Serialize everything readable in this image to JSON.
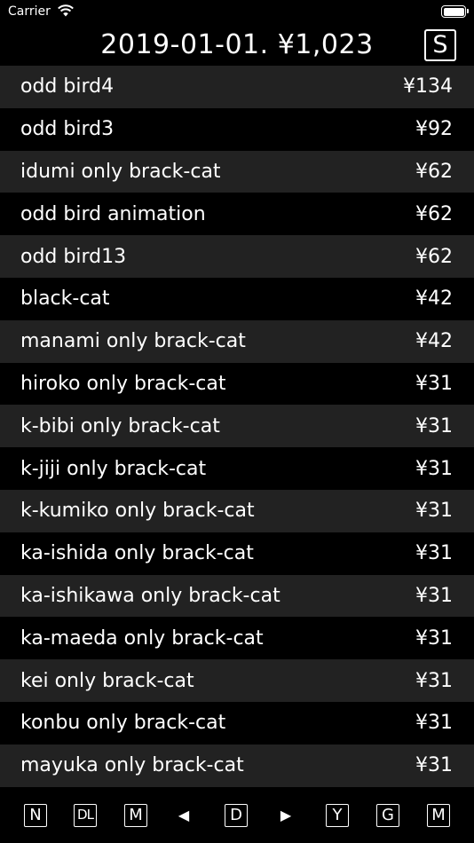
{
  "status": {
    "carrier": "Carrier"
  },
  "header": {
    "title": "2019-01-01.  ¥1,023",
    "s_label": "S"
  },
  "rows": [
    {
      "name": "odd bird4",
      "price": "¥134"
    },
    {
      "name": "odd bird3",
      "price": "¥92"
    },
    {
      "name": "idumi only brack-cat",
      "price": "¥62"
    },
    {
      "name": "odd bird animation",
      "price": "¥62"
    },
    {
      "name": "odd bird13",
      "price": "¥62"
    },
    {
      "name": "black-cat",
      "price": "¥42"
    },
    {
      "name": "manami only brack-cat",
      "price": "¥42"
    },
    {
      "name": "hiroko only brack-cat",
      "price": "¥31"
    },
    {
      "name": "k-bibi only brack-cat",
      "price": "¥31"
    },
    {
      "name": "k-jiji only brack-cat",
      "price": "¥31"
    },
    {
      "name": "k-kumiko only brack-cat",
      "price": "¥31"
    },
    {
      "name": "ka-ishida only brack-cat",
      "price": "¥31"
    },
    {
      "name": "ka-ishikawa only brack-cat",
      "price": "¥31"
    },
    {
      "name": "ka-maeda only brack-cat",
      "price": "¥31"
    },
    {
      "name": "kei only brack-cat",
      "price": "¥31"
    },
    {
      "name": "konbu only brack-cat",
      "price": "¥31"
    },
    {
      "name": "mayuka only brack-cat",
      "price": "¥31"
    }
  ],
  "toolbar": {
    "n": "N",
    "dl": "DL",
    "m1": "M",
    "prev": "◀",
    "d": "D",
    "next": "▶",
    "y": "Y",
    "g": "G",
    "m2": "M"
  }
}
